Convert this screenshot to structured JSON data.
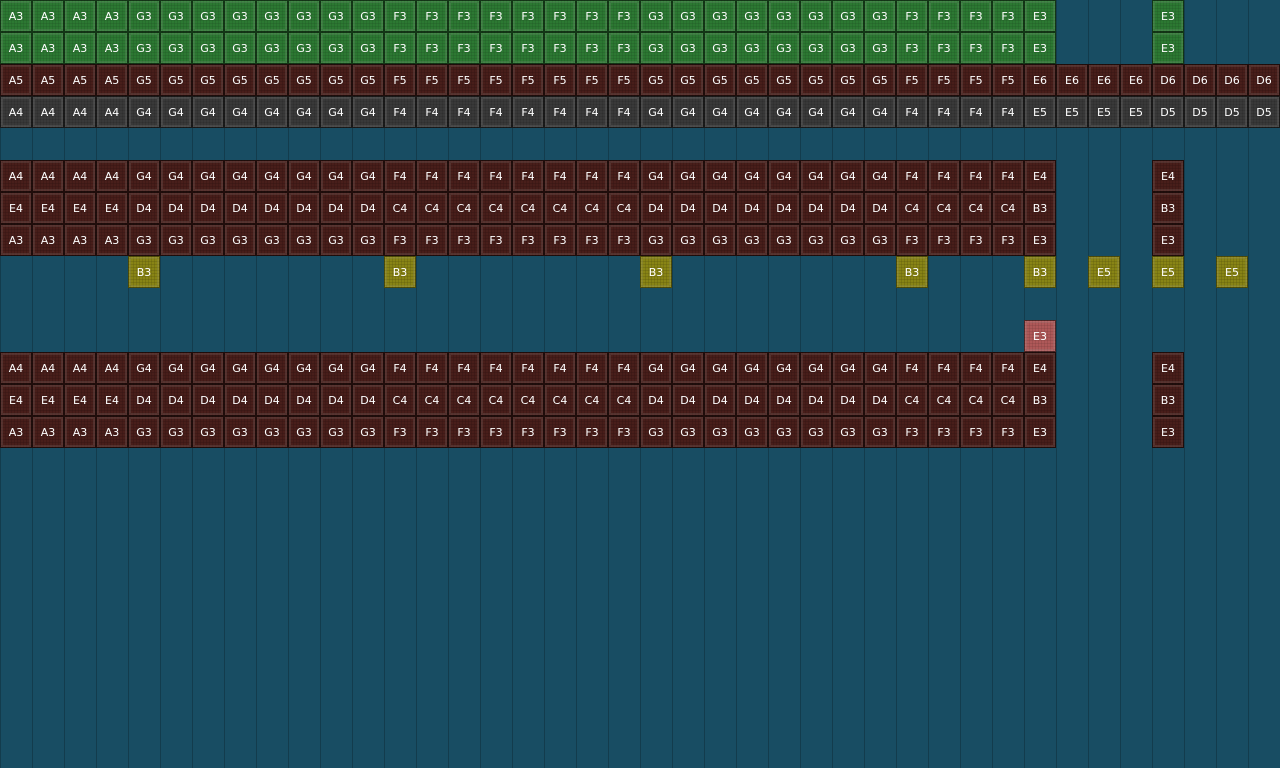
{
  "colors": {
    "background": "#184d63",
    "green": "#2e7d34",
    "maroon": "#4b1f1b",
    "gray": "#3c3c3c",
    "gold": "#8f8a16",
    "pink": "#b55b5b"
  },
  "tracks": [
    {
      "name": "row-1",
      "color": "green",
      "notes": [
        "A3",
        "A3",
        "A3",
        "A3",
        "G3",
        "G3",
        "G3",
        "G3",
        "G3",
        "G3",
        "G3",
        "G3",
        "F3",
        "F3",
        "F3",
        "F3",
        "F3",
        "F3",
        "F3",
        "F3",
        "G3",
        "G3",
        "G3",
        "G3",
        "G3",
        "G3",
        "G3",
        "G3",
        "F3",
        "F3",
        "F3",
        "F3",
        "E3",
        null,
        null,
        null,
        "E3"
      ]
    },
    {
      "name": "row-2",
      "color": "green",
      "notes": [
        "A3",
        "A3",
        "A3",
        "A3",
        "G3",
        "G3",
        "G3",
        "G3",
        "G3",
        "G3",
        "G3",
        "G3",
        "F3",
        "F3",
        "F3",
        "F3",
        "F3",
        "F3",
        "F3",
        "F3",
        "G3",
        "G3",
        "G3",
        "G3",
        "G3",
        "G3",
        "G3",
        "G3",
        "F3",
        "F3",
        "F3",
        "F3",
        "E3",
        null,
        null,
        null,
        "E3"
      ]
    },
    {
      "name": "row-3",
      "color": "maroon",
      "notes": [
        "A5",
        "A5",
        "A5",
        "A5",
        "G5",
        "G5",
        "G5",
        "G5",
        "G5",
        "G5",
        "G5",
        "G5",
        "F5",
        "F5",
        "F5",
        "F5",
        "F5",
        "F5",
        "F5",
        "F5",
        "G5",
        "G5",
        "G5",
        "G5",
        "G5",
        "G5",
        "G5",
        "G5",
        "F5",
        "F5",
        "F5",
        "F5",
        "E6",
        "E6",
        "E6",
        "E6",
        "D6",
        "D6",
        "D6",
        "D6"
      ]
    },
    {
      "name": "row-4",
      "color": "gray",
      "notes": [
        "A4",
        "A4",
        "A4",
        "A4",
        "G4",
        "G4",
        "G4",
        "G4",
        "G4",
        "G4",
        "G4",
        "G4",
        "F4",
        "F4",
        "F4",
        "F4",
        "F4",
        "F4",
        "F4",
        "F4",
        "G4",
        "G4",
        "G4",
        "G4",
        "G4",
        "G4",
        "G4",
        "G4",
        "F4",
        "F4",
        "F4",
        "F4",
        "E5",
        "E5",
        "E5",
        "E5",
        "D5",
        "D5",
        "D5",
        "D5"
      ]
    },
    {
      "name": "row-5",
      "color": null,
      "notes": []
    },
    {
      "name": "row-6",
      "color": "maroon",
      "notes": [
        "A4",
        "A4",
        "A4",
        "A4",
        "G4",
        "G4",
        "G4",
        "G4",
        "G4",
        "G4",
        "G4",
        "G4",
        "F4",
        "F4",
        "F4",
        "F4",
        "F4",
        "F4",
        "F4",
        "F4",
        "G4",
        "G4",
        "G4",
        "G4",
        "G4",
        "G4",
        "G4",
        "G4",
        "F4",
        "F4",
        "F4",
        "F4",
        "E4",
        null,
        null,
        null,
        "E4"
      ]
    },
    {
      "name": "row-7",
      "color": "maroon",
      "notes": [
        "E4",
        "E4",
        "E4",
        "E4",
        "D4",
        "D4",
        "D4",
        "D4",
        "D4",
        "D4",
        "D4",
        "D4",
        "C4",
        "C4",
        "C4",
        "C4",
        "C4",
        "C4",
        "C4",
        "C4",
        "D4",
        "D4",
        "D4",
        "D4",
        "D4",
        "D4",
        "D4",
        "D4",
        "C4",
        "C4",
        "C4",
        "C4",
        "B3",
        null,
        null,
        null,
        "B3"
      ]
    },
    {
      "name": "row-8",
      "color": "maroon",
      "notes": [
        "A3",
        "A3",
        "A3",
        "A3",
        "G3",
        "G3",
        "G3",
        "G3",
        "G3",
        "G3",
        "G3",
        "G3",
        "F3",
        "F3",
        "F3",
        "F3",
        "F3",
        "F3",
        "F3",
        "F3",
        "G3",
        "G3",
        "G3",
        "G3",
        "G3",
        "G3",
        "G3",
        "G3",
        "F3",
        "F3",
        "F3",
        "F3",
        "E3",
        null,
        null,
        null,
        "E3"
      ]
    },
    {
      "name": "row-9",
      "color": "gold",
      "notes": [
        null,
        null,
        null,
        null,
        "B3",
        null,
        null,
        null,
        null,
        null,
        null,
        null,
        "B3",
        null,
        null,
        null,
        null,
        null,
        null,
        null,
        "B3",
        null,
        null,
        null,
        null,
        null,
        null,
        null,
        "B3",
        null,
        null,
        null,
        "B3",
        null,
        "E5",
        null,
        "E5",
        null,
        "E5"
      ]
    },
    {
      "name": "row-10",
      "color": null,
      "notes": []
    },
    {
      "name": "row-11",
      "color": "pink",
      "notes": [
        null,
        null,
        null,
        null,
        null,
        null,
        null,
        null,
        null,
        null,
        null,
        null,
        null,
        null,
        null,
        null,
        null,
        null,
        null,
        null,
        null,
        null,
        null,
        null,
        null,
        null,
        null,
        null,
        null,
        null,
        null,
        null,
        "E3"
      ]
    },
    {
      "name": "row-12",
      "color": "maroon",
      "notes": [
        "A4",
        "A4",
        "A4",
        "A4",
        "G4",
        "G4",
        "G4",
        "G4",
        "G4",
        "G4",
        "G4",
        "G4",
        "F4",
        "F4",
        "F4",
        "F4",
        "F4",
        "F4",
        "F4",
        "F4",
        "G4",
        "G4",
        "G4",
        "G4",
        "G4",
        "G4",
        "G4",
        "G4",
        "F4",
        "F4",
        "F4",
        "F4",
        "E4",
        null,
        null,
        null,
        "E4"
      ]
    },
    {
      "name": "row-13",
      "color": "maroon",
      "notes": [
        "E4",
        "E4",
        "E4",
        "E4",
        "D4",
        "D4",
        "D4",
        "D4",
        "D4",
        "D4",
        "D4",
        "D4",
        "C4",
        "C4",
        "C4",
        "C4",
        "C4",
        "C4",
        "C4",
        "C4",
        "D4",
        "D4",
        "D4",
        "D4",
        "D4",
        "D4",
        "D4",
        "D4",
        "C4",
        "C4",
        "C4",
        "C4",
        "B3",
        null,
        null,
        null,
        "B3"
      ]
    },
    {
      "name": "row-14",
      "color": "maroon",
      "notes": [
        "A3",
        "A3",
        "A3",
        "A3",
        "G3",
        "G3",
        "G3",
        "G3",
        "G3",
        "G3",
        "G3",
        "G3",
        "F3",
        "F3",
        "F3",
        "F3",
        "F3",
        "F3",
        "F3",
        "F3",
        "G3",
        "G3",
        "G3",
        "G3",
        "G3",
        "G3",
        "G3",
        "G3",
        "F3",
        "F3",
        "F3",
        "F3",
        "E3",
        null,
        null,
        null,
        "E3"
      ]
    }
  ]
}
